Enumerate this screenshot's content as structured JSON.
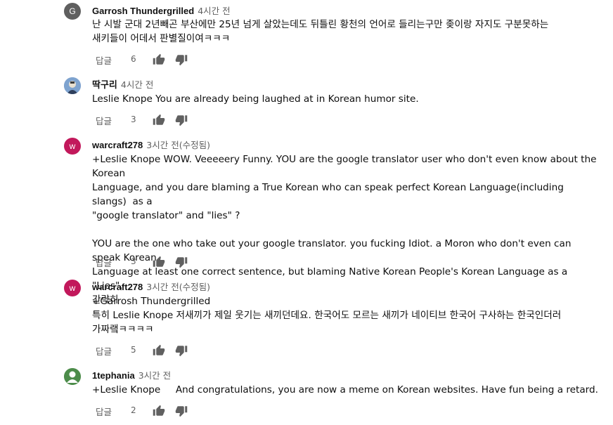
{
  "reply_label": "답글",
  "comments": [
    {
      "author": "Garrosh Thundergrilled",
      "time": "4시간 전",
      "avatar_letter": "G",
      "avatar_color": "#5f5f5f",
      "text": "난 시발 군대 2년빼곤 부산에만 25년 넘게 살았는데도 뒤틀린 황천의 언어로 들리는구만 좆이랑 자지도 구분못하는\n새키들이 어데서 판별질이여ㅋㅋㅋ",
      "likes": "6"
    },
    {
      "author": "딱구리",
      "time": "4시간 전",
      "avatar_letter": "",
      "avatar_color": "#4a6fa5",
      "text": "Leslie Knope You are already being laughed at in Korean humor site.",
      "likes": "3"
    },
    {
      "author": "warcraft278",
      "time": "3시간 전(수정됨)",
      "avatar_letter": "w",
      "avatar_color": "#c2185b",
      "text": "+Leslie Knope WOW. Veeeeery Funny. YOU are the google translator user who don't even know about the Korean\nLanguage, and you dare blaming a True Korean who can speak perfect Korean Language(including slangs)  as a\n\"google translator\" and \"lies\" ?\n\nYOU are the one who take out your google translator. you fucking Idiot. a Moron who don't even can speak Korean\nLanguage at least one correct sentence, but blaming Native Korean People's Korean Language as a \"Lies\".\n간략히",
      "likes": "3"
    },
    {
      "author": "warcraft278",
      "time": "3시간 전(수정됨)",
      "avatar_letter": "w",
      "avatar_color": "#c2185b",
      "text": "+Garrosh Thundergrilled\n특히 Leslie Knope 저새끼가 제일 웃기는 새끼던데요. 한국어도 모르는 새끼가 네이티브 한국어 구사하는 한국인더러\n가짜랰ㅋㅋㅋㅋ",
      "likes": "5"
    },
    {
      "author": "1tephania",
      "time": "3시간 전",
      "avatar_letter": "",
      "avatar_color": "#4c8c4a",
      "text": "+Leslie Knope     And congratulations, you are now a meme on Korean websites. Have fun being a retard.",
      "likes": "2"
    }
  ]
}
